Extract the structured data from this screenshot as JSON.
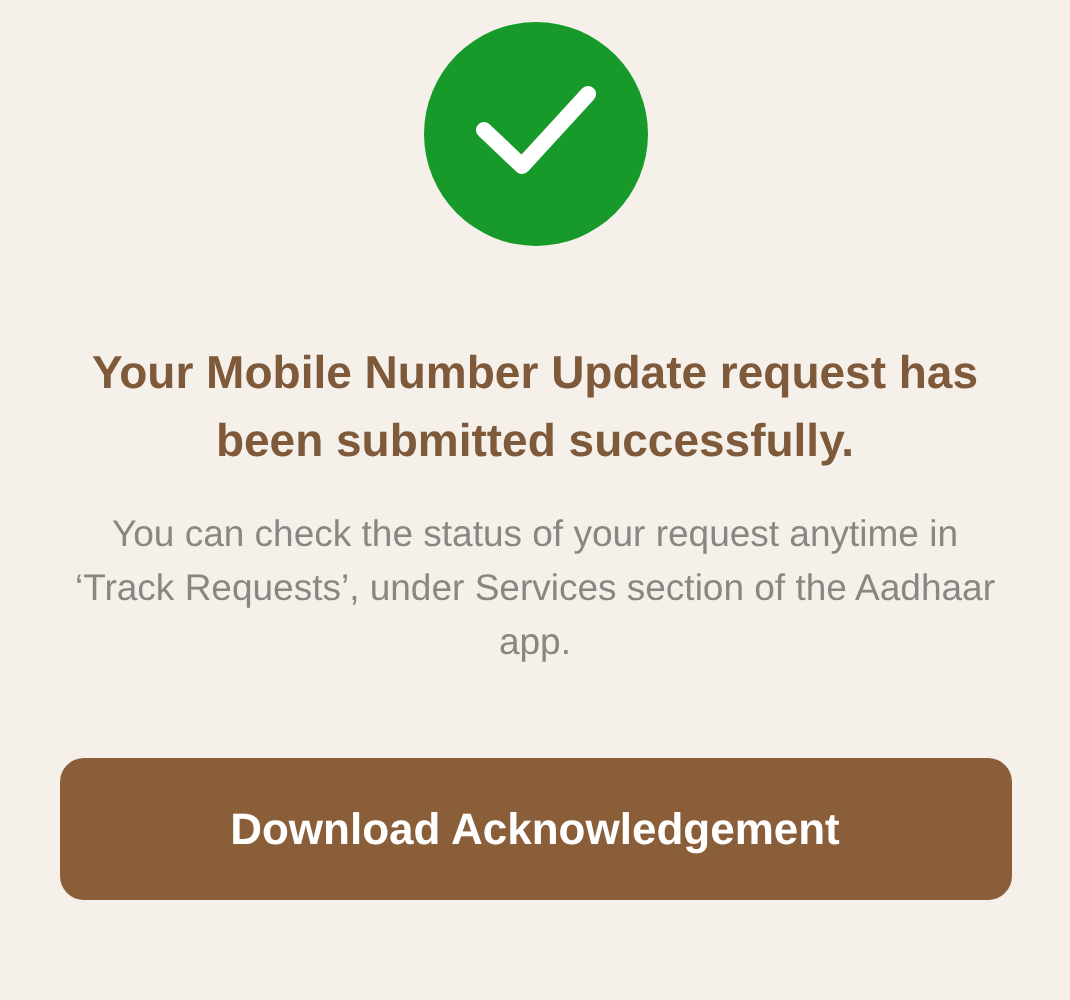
{
  "status": {
    "kind": "success"
  },
  "title": "Your Mobile Number Update request has been submitted successfully.",
  "message": "You can check the status of your request anytime in ‘Track Requests’, under Services section of the Aadhaar app.",
  "button": {
    "label": "Download Acknowledgement"
  }
}
